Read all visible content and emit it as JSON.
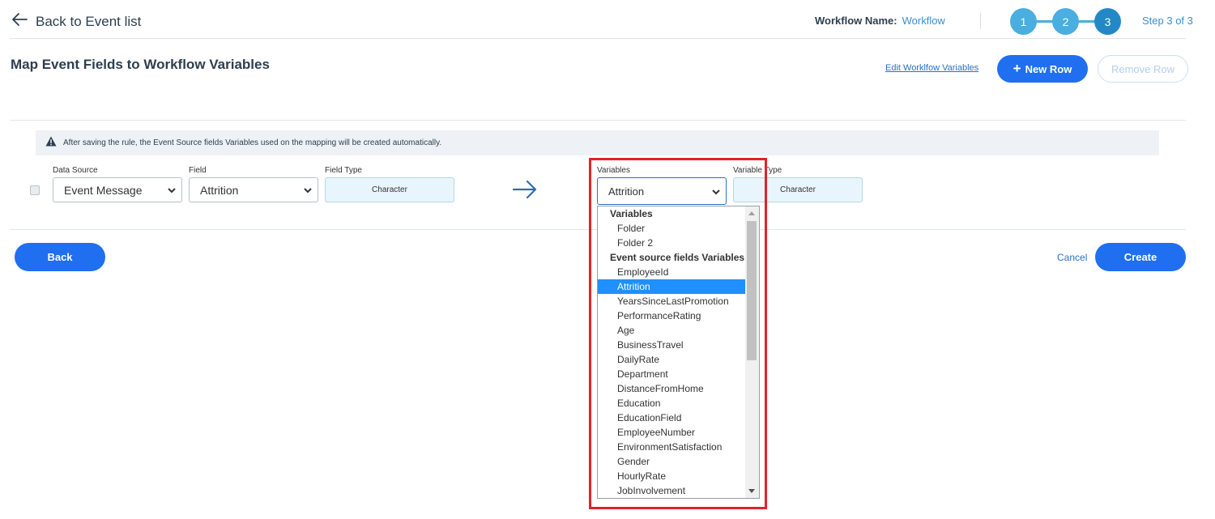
{
  "header": {
    "back_label": "Back to Event list",
    "workflow_name_label": "Workflow Name:",
    "workflow_name_value": "Workflow",
    "steps": [
      "1",
      "2",
      "3"
    ],
    "current_step": 3,
    "step_text": "Step 3 of 3"
  },
  "page": {
    "title": "Map Event Fields to Workflow Variables",
    "edit_variables_link": "Edit Worklfow Variables",
    "new_row_label": "New Row",
    "remove_row_label": "Remove Row"
  },
  "info": {
    "message": "After saving the rule, the Event Source fields Variables used on the mapping will be created automatically."
  },
  "mapping_row": {
    "data_source_label": "Data Source",
    "data_source_value": "Event Message",
    "field_label": "Field",
    "field_value": "Attrition",
    "field_type_label": "Field Type",
    "field_type_value": "Character",
    "variables_label": "Variables",
    "variables_value": "Attrition",
    "variable_type_label": "Variable Type",
    "variable_type_value": "Character"
  },
  "variables_dropdown": {
    "groups": [
      {
        "label": "Variables",
        "options": [
          "Folder",
          "Folder 2"
        ]
      },
      {
        "label": "Event source fields Variables",
        "options": [
          "EmployeeId",
          "Attrition",
          "YearsSinceLastPromotion",
          "PerformanceRating",
          "Age",
          "BusinessTravel",
          "DailyRate",
          "Department",
          "DistanceFromHome",
          "Education",
          "EducationField",
          "EmployeeNumber",
          "EnvironmentSatisfaction",
          "Gender",
          "HourlyRate",
          "JobInvolvement"
        ]
      }
    ],
    "selected": "Attrition"
  },
  "footer": {
    "back_label": "Back",
    "cancel_label": "Cancel",
    "create_label": "Create"
  },
  "colors": {
    "primary_button": "#1f6ff0",
    "stepper_done": "#4aaee0",
    "stepper_current": "#2389c6",
    "link": "#2a70c8",
    "selected_option": "#1e90ff",
    "highlight_frame": "#e3222b"
  },
  "icons": {
    "back": "arrow-left-icon",
    "info": "warning-triangle-icon",
    "mapping": "arrow-right-icon",
    "select": "chevron-down-icon",
    "new_row": "plus-icon"
  }
}
